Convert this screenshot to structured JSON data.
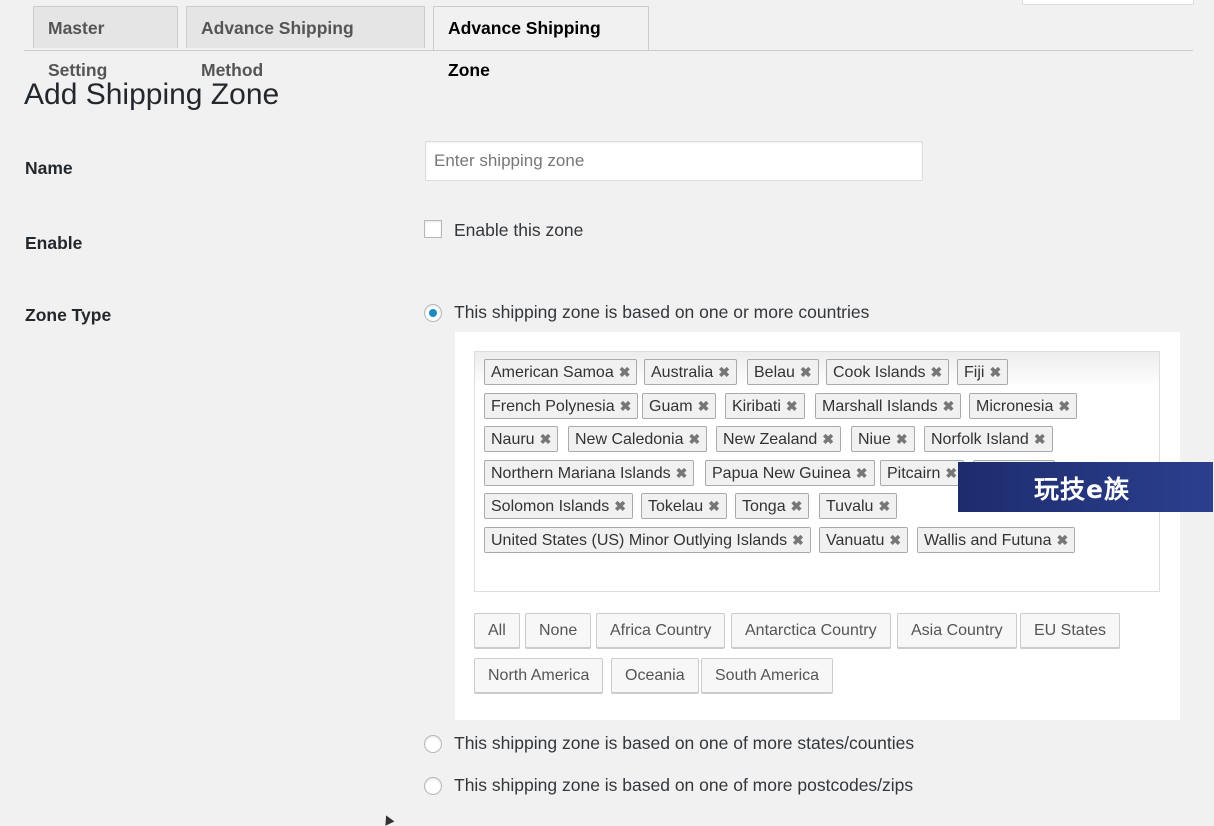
{
  "tabs": [
    {
      "label": "Master Setting"
    },
    {
      "label": "Advance Shipping Method"
    },
    {
      "label": "Advance Shipping Zone"
    }
  ],
  "page_title": "Add Shipping Zone",
  "form": {
    "name_label": "Name",
    "name_placeholder": "Enter shipping zone",
    "name_value": "",
    "enable_label": "Enable",
    "enable_checkbox_text": "Enable this zone",
    "enable_checked": false,
    "zone_type_label": "Zone Type",
    "zone_type_options": [
      {
        "label": "This shipping zone is based on one or more countries",
        "selected": true
      },
      {
        "label": "This shipping zone is based on one of more states/counties",
        "selected": false
      },
      {
        "label": "This shipping zone is based on one of more postcodes/zips",
        "selected": false
      }
    ]
  },
  "countries": {
    "remove_glyph": "✖",
    "selected": [
      "American Samoa",
      "Australia",
      "Belau",
      "Cook Islands",
      "Fiji",
      "French Polynesia",
      "Guam",
      "Kiribati",
      "Marshall Islands",
      "Micronesia",
      "Nauru",
      "New Caledonia",
      "New Zealand",
      "Niue",
      "Norfolk Island",
      "Northern Mariana Islands",
      "Papua New Guinea",
      "Pitcairn",
      "",
      "Solomon Islands",
      "Tokelau",
      "Tonga",
      "Tuvalu",
      "United States (US) Minor Outlying Islands",
      "Vanuatu",
      "Wallis and Futuna"
    ],
    "quick_select_buttons": [
      "All",
      "None",
      "Africa Country",
      "Antarctica Country",
      "Asia Country",
      "EU States",
      "North America",
      "Oceania",
      "South America"
    ]
  },
  "watermark": {
    "text": "玩技e族"
  },
  "colors": {
    "radio_selected": "#1e8cbe",
    "banner_bg": "#1d2c6d"
  }
}
